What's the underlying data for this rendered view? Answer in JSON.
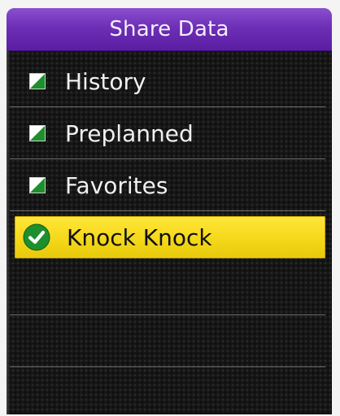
{
  "title": "Share Data",
  "items": [
    {
      "label": "History",
      "state": "checked",
      "icon": "checkbox-checked-icon"
    },
    {
      "label": "Preplanned",
      "state": "checked",
      "icon": "checkbox-checked-icon"
    },
    {
      "label": "Favorites",
      "state": "checked",
      "icon": "checkbox-checked-icon"
    },
    {
      "label": "Knock Knock",
      "state": "selected",
      "icon": "check-circle-icon"
    }
  ],
  "colors": {
    "title_bar": "#6d2fb6",
    "highlight": "#f5d81a",
    "check_green": "#1d8f2c",
    "background": "#161616"
  }
}
